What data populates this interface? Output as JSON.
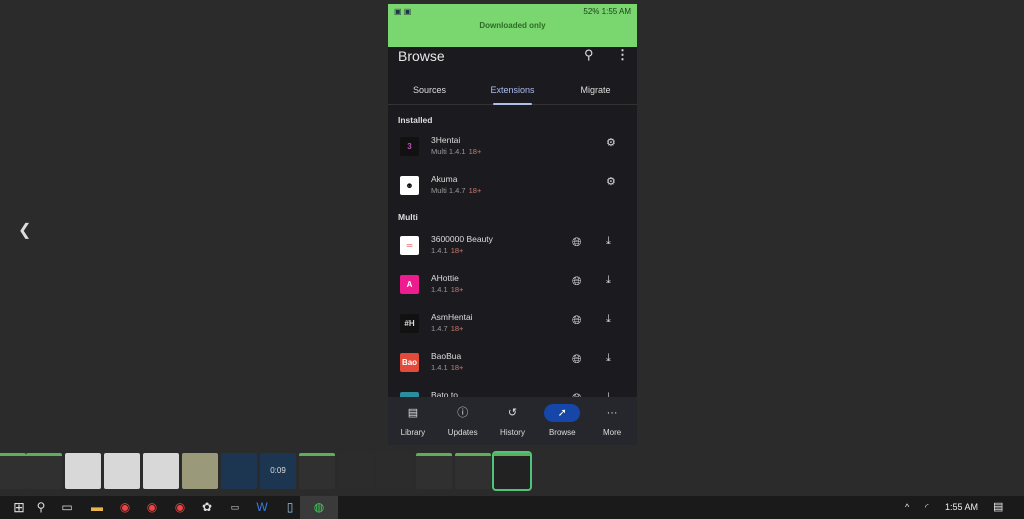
{
  "status_bar": {
    "left_icons": "▣ ▣",
    "right": "52% 1:55 AM",
    "banner": "Downloaded only"
  },
  "header": {
    "title": "Browse",
    "search_icon": "⚲",
    "more_icon": "⋮"
  },
  "tabs": [
    {
      "label": "Sources"
    },
    {
      "label": "Extensions"
    },
    {
      "label": "Migrate"
    }
  ],
  "sections": {
    "installed": "Installed",
    "multi": "Multi"
  },
  "installed": [
    {
      "name": "3Hentai",
      "version": "Multi 1.4.1",
      "nsfw": "18+",
      "icon_text": "3",
      "icon_bg": "#111",
      "icon_fg": "#c050c0"
    },
    {
      "name": "Akuma",
      "version": "Multi 1.4.7",
      "nsfw": "18+",
      "icon_text": "☻",
      "icon_bg": "#fff",
      "icon_fg": "#000"
    }
  ],
  "multi": [
    {
      "name": "3600000 Beauty",
      "version": "1.4.1",
      "nsfw": "18+",
      "icon_text": "═",
      "icon_bg": "#fff",
      "icon_fg": "#d33"
    },
    {
      "name": "AHottie",
      "version": "1.4.1",
      "nsfw": "18+",
      "icon_text": "A",
      "icon_bg": "#ee1c8e",
      "icon_fg": "#fff"
    },
    {
      "name": "AsmHentai",
      "version": "1.4.7",
      "nsfw": "18+",
      "icon_text": "#H",
      "icon_bg": "#111",
      "icon_fg": "#ddd"
    },
    {
      "name": "BaoBua",
      "version": "1.4.1",
      "nsfw": "18+",
      "icon_text": "Bao",
      "icon_bg": "#e24a3a",
      "icon_fg": "#fff"
    },
    {
      "name": "Bato.to",
      "version": "",
      "nsfw": "",
      "icon_text": "B",
      "icon_bg": "#2a8da0",
      "icon_fg": "#fff"
    }
  ],
  "nav": [
    {
      "label": "Library",
      "icon": "▤"
    },
    {
      "label": "Updates",
      "icon": "ⓘ"
    },
    {
      "label": "History",
      "icon": "↺"
    },
    {
      "label": "Browse",
      "icon": "➚"
    },
    {
      "label": "More",
      "icon": "···"
    }
  ],
  "taskbar": {
    "time": "1:55 AM",
    "thumb_text": "0:09"
  }
}
